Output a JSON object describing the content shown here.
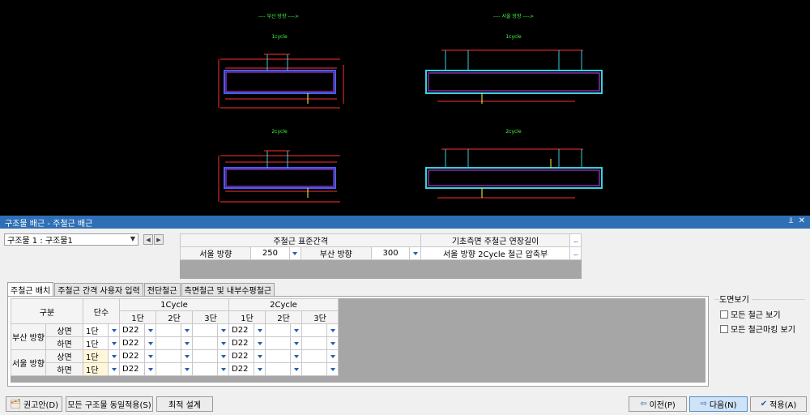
{
  "drawing": {
    "left_header": "---- 부산 방향 ---->",
    "right_header": "---- 서울 방향 ---->",
    "cycle1_label": "1cycle",
    "cycle2_label": "2cycle"
  },
  "panel": {
    "title": "구조물 배근 - 주철근 배근",
    "pin_icon": "pin-icon",
    "close_icon": "close-icon"
  },
  "structure_select": {
    "value": "구조물 1 : 구조물1"
  },
  "spacing": {
    "standard_header": "주철근 표준간격",
    "extension_header": "기초측면 주철근 연장길이",
    "seoul_label": "서울 방향",
    "seoul_value": "250",
    "busan_label": "부산 방향",
    "busan_value": "300",
    "extension_row_label": "서울 방향 2Cycle 철근 압축부"
  },
  "tabs": [
    "주철근 배치",
    "주철근 간격 사용자 입력",
    "전단철근",
    "측면철근 및 내부수평철근"
  ],
  "grid": {
    "header_category": "구분",
    "header_tiers": "단수",
    "header_cycle1": "1Cycle",
    "header_cycle2": "2Cycle",
    "sub_headers": [
      "1단",
      "2단",
      "3단",
      "1단",
      "2단",
      "3단"
    ],
    "rows": [
      {
        "group": "부산 방향",
        "face": "상면",
        "tiers": "1단",
        "c1": [
          "D22",
          "",
          ""
        ],
        "c2": [
          "D22",
          "",
          ""
        ],
        "highlight": false
      },
      {
        "group": "",
        "face": "하면",
        "tiers": "1단",
        "c1": [
          "D22",
          "",
          ""
        ],
        "c2": [
          "D22",
          "",
          ""
        ],
        "highlight": false
      },
      {
        "group": "서울 방향",
        "face": "상면",
        "tiers": "1단",
        "c1": [
          "D22",
          "",
          ""
        ],
        "c2": [
          "D22",
          "",
          ""
        ],
        "highlight": true
      },
      {
        "group": "",
        "face": "하면",
        "tiers": "1단",
        "c1": [
          "D22",
          "",
          ""
        ],
        "c2": [
          "D22",
          "",
          ""
        ],
        "highlight": true
      }
    ]
  },
  "drawing_view": {
    "title": "도면보기",
    "all_rebar": "모든 철근 보기",
    "all_marking": "모든 철근마킹 보기",
    "all_rebar_checked": false,
    "all_marking_checked": false
  },
  "buttons": {
    "recommend": "권고안(D)",
    "apply_all": "모든 구조물 동일적용(S)",
    "optimize": "최적 설계",
    "prev": "이전(P)",
    "next": "다음(N)",
    "apply": "적용(A)"
  },
  "colors": {
    "accent": "#2f6fb5",
    "cad_red": "#ff3030",
    "cad_cyan": "#3ad0e0",
    "cad_magenta": "#d040ff",
    "cad_blue": "#4060ff",
    "cad_green": "#40ff40",
    "cad_yellow": "#ffff40"
  }
}
